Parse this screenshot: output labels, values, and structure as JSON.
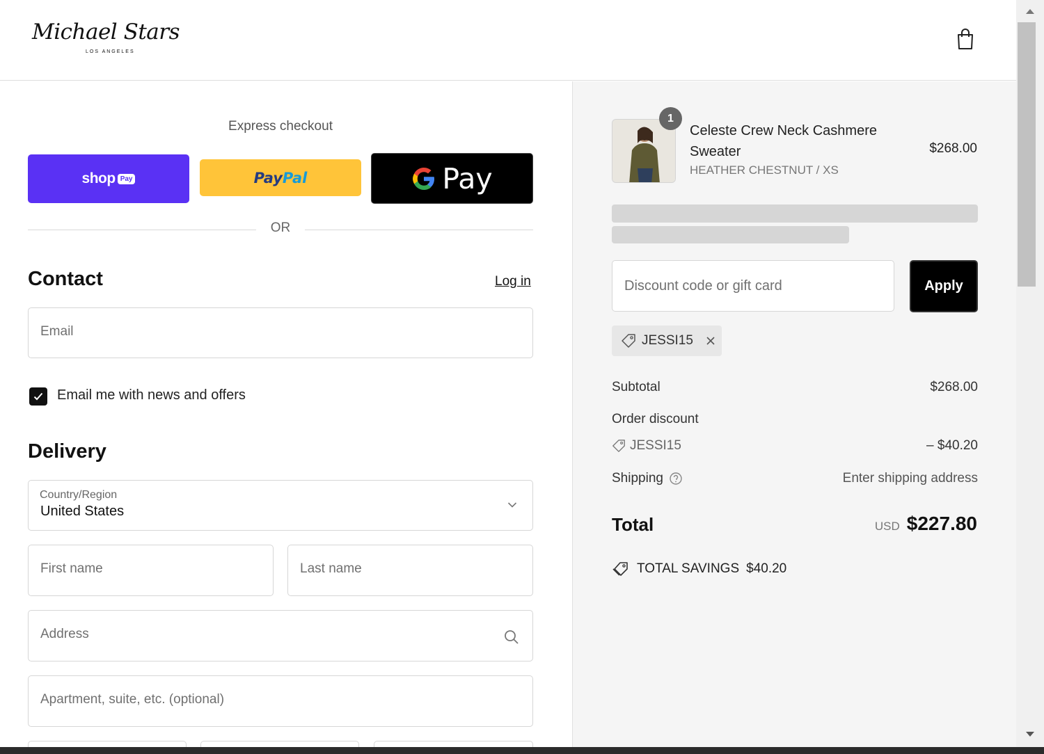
{
  "header": {
    "logo_script": "Michael Stars",
    "logo_sub": "LOS ANGELES"
  },
  "express": {
    "title": "Express checkout",
    "shop_label": "shop",
    "shop_pay_pill": "Pay",
    "paypal_part1": "Pay",
    "paypal_part2": "Pal",
    "gpay_label": "Pay",
    "or_label": "OR"
  },
  "contact": {
    "title": "Contact",
    "login_link": "Log in",
    "email_placeholder": "Email",
    "newsletter_label": "Email me with news and offers",
    "newsletter_checked": true
  },
  "delivery": {
    "title": "Delivery",
    "country_label": "Country/Region",
    "country_value": "United States",
    "first_name_placeholder": "First name",
    "last_name_placeholder": "Last name",
    "address_placeholder": "Address",
    "apartment_placeholder": "Apartment, suite, etc. (optional)"
  },
  "summary": {
    "item": {
      "quantity": "1",
      "name": "Celeste Crew Neck Cashmere Sweater",
      "variant": "HEATHER CHESTNUT / XS",
      "price": "$268.00"
    },
    "discount_placeholder": "Discount code or gift card",
    "apply_label": "Apply",
    "applied_code": "JESSI15",
    "subtotal_label": "Subtotal",
    "subtotal_value": "$268.00",
    "order_discount_label": "Order discount",
    "discount_code": "JESSI15",
    "discount_value": "– $40.20",
    "shipping_label": "Shipping",
    "shipping_value": "Enter shipping address",
    "total_label": "Total",
    "total_currency": "USD",
    "total_value": "$227.80",
    "savings_label": "TOTAL SAVINGS",
    "savings_value": "$40.20"
  },
  "colors": {
    "shop_pay": "#5a31f4",
    "paypal": "#ffc439",
    "gpay": "#000000",
    "summary_bg": "#f5f5f5"
  }
}
